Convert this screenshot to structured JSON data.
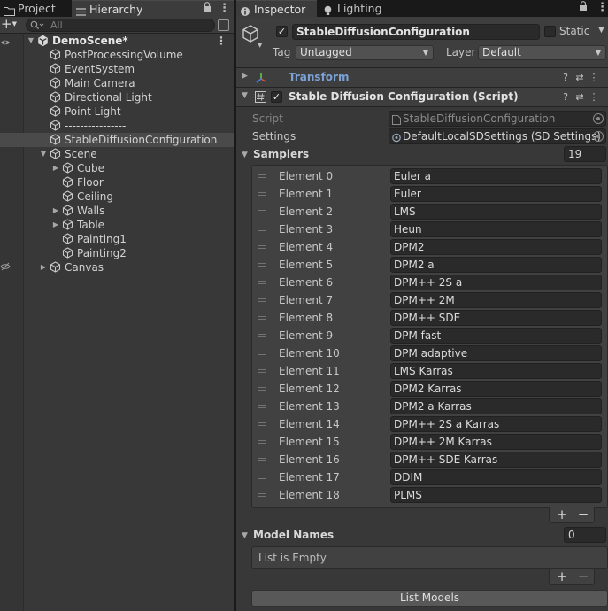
{
  "left_panel": {
    "tabs": [
      {
        "label": "Project",
        "icon": "folder-icon"
      },
      {
        "label": "Hierarchy",
        "icon": "list-icon"
      }
    ],
    "search": {
      "placeholder": "All",
      "value": ""
    },
    "add_label": "+",
    "tree": [
      {
        "label": "DemoScene*",
        "depth": 0,
        "fold": "open",
        "kind": "scene"
      },
      {
        "label": "PostProcessingVolume",
        "depth": 1,
        "fold": "none",
        "kind": "object"
      },
      {
        "label": "EventSystem",
        "depth": 1,
        "fold": "none",
        "kind": "object"
      },
      {
        "label": "Main Camera",
        "depth": 1,
        "fold": "none",
        "kind": "object"
      },
      {
        "label": "Directional Light",
        "depth": 1,
        "fold": "none",
        "kind": "object"
      },
      {
        "label": "Point Light",
        "depth": 1,
        "fold": "none",
        "kind": "object"
      },
      {
        "label": "----------------",
        "depth": 1,
        "fold": "none",
        "kind": "object"
      },
      {
        "label": "StableDiffusionConfiguration",
        "depth": 1,
        "fold": "none",
        "kind": "object",
        "selected": true
      },
      {
        "label": "Scene",
        "depth": 1,
        "fold": "open",
        "kind": "object"
      },
      {
        "label": "Cube",
        "depth": 2,
        "fold": "closed",
        "kind": "object"
      },
      {
        "label": "Floor",
        "depth": 2,
        "fold": "none",
        "kind": "object"
      },
      {
        "label": "Ceiling",
        "depth": 2,
        "fold": "none",
        "kind": "object"
      },
      {
        "label": "Walls",
        "depth": 2,
        "fold": "closed",
        "kind": "object"
      },
      {
        "label": "Table",
        "depth": 2,
        "fold": "closed",
        "kind": "object"
      },
      {
        "label": "Painting1",
        "depth": 2,
        "fold": "none",
        "kind": "object"
      },
      {
        "label": "Painting2",
        "depth": 2,
        "fold": "none",
        "kind": "object"
      },
      {
        "label": "Canvas",
        "depth": 1,
        "fold": "closed",
        "kind": "object"
      }
    ]
  },
  "inspector": {
    "tabs": [
      {
        "label": "Inspector",
        "icon": "info-icon"
      },
      {
        "label": "Lighting",
        "icon": "bulb-icon"
      }
    ],
    "object": {
      "name": "StableDiffusionConfiguration",
      "active": true,
      "static_label": "Static",
      "static": false,
      "tag_label": "Tag",
      "tag_value": "Untagged",
      "layer_label": "Layer",
      "layer_value": "Default"
    },
    "components": {
      "transform_title": "Transform",
      "script_title": "Stable Diffusion Configuration (Script)",
      "script_enabled": true
    },
    "script_props": {
      "script_label": "Script",
      "script_value": "StableDiffusionConfiguration",
      "settings_label": "Settings",
      "settings_value": "DefaultLocalSDSettings (SD Settings)"
    },
    "samplers": {
      "label": "Samplers",
      "count": "19",
      "items": [
        {
          "label": "Element 0",
          "value": "Euler a"
        },
        {
          "label": "Element 1",
          "value": "Euler"
        },
        {
          "label": "Element 2",
          "value": "LMS"
        },
        {
          "label": "Element 3",
          "value": "Heun"
        },
        {
          "label": "Element 4",
          "value": "DPM2"
        },
        {
          "label": "Element 5",
          "value": "DPM2 a"
        },
        {
          "label": "Element 6",
          "value": "DPM++ 2S a"
        },
        {
          "label": "Element 7",
          "value": "DPM++ 2M"
        },
        {
          "label": "Element 8",
          "value": "DPM++ SDE"
        },
        {
          "label": "Element 9",
          "value": "DPM fast"
        },
        {
          "label": "Element 10",
          "value": "DPM adaptive"
        },
        {
          "label": "Element 11",
          "value": "LMS Karras"
        },
        {
          "label": "Element 12",
          "value": "DPM2 Karras"
        },
        {
          "label": "Element 13",
          "value": "DPM2 a Karras"
        },
        {
          "label": "Element 14",
          "value": "DPM++ 2S a Karras"
        },
        {
          "label": "Element 15",
          "value": "DPM++ 2M Karras"
        },
        {
          "label": "Element 16",
          "value": "DPM++ SDE Karras"
        },
        {
          "label": "Element 17",
          "value": "DDIM"
        },
        {
          "label": "Element 18",
          "value": "PLMS"
        }
      ],
      "add_label": "+",
      "remove_label": "−"
    },
    "model_names": {
      "label": "Model Names",
      "count": "0",
      "empty_text": "List is Empty",
      "add_label": "+",
      "remove_label": "−"
    },
    "list_models_button": "List Models"
  }
}
